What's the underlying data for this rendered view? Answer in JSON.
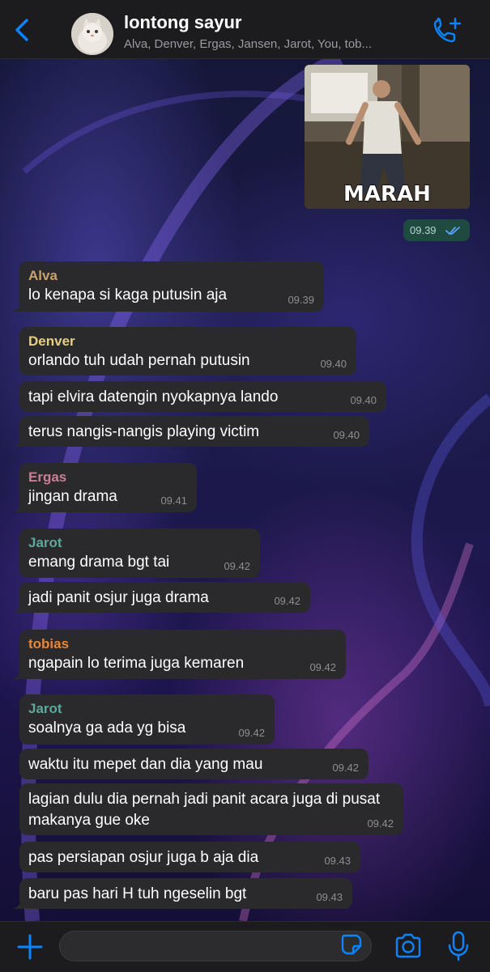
{
  "header": {
    "title": "lontong sayur",
    "subtitle": "Alva, Denver, Ergas, Jansen, Jarot, You, tob..."
  },
  "image_message": {
    "caption": "MARAH",
    "time": "09.39",
    "status": "read-double-check-icon"
  },
  "messages": [
    {
      "sender": "Alva",
      "sender_color": "#c8a26e",
      "text": "lo kenapa si kaga putusin aja",
      "time": "09.39"
    },
    {
      "sender": "Denver",
      "sender_color": "#e6cf86",
      "text": "orlando tuh udah pernah putusin",
      "time": "09.40"
    },
    {
      "sender": "",
      "text": "tapi elvira datengin nyokapnya lando",
      "time": "09.40"
    },
    {
      "sender": "",
      "text": "terus nangis-nangis playing victim",
      "time": "09.40"
    },
    {
      "sender": "Ergas",
      "sender_color": "#c97f93",
      "text": "jingan drama",
      "time": "09.41"
    },
    {
      "sender": "Jarot",
      "sender_color": "#5fa89c",
      "text": "emang drama bgt tai",
      "time": "09.42"
    },
    {
      "sender": "",
      "text": "jadi panit osjur juga drama",
      "time": "09.42"
    },
    {
      "sender": "tobias",
      "sender_color": "#e8863a",
      "text": "ngapain lo terima juga kemaren",
      "time": "09.42"
    },
    {
      "sender": "Jarot",
      "sender_color": "#5fa89c",
      "text": "soalnya ga ada yg bisa",
      "time": "09.42"
    },
    {
      "sender": "",
      "text": "waktu itu mepet dan dia yang mau",
      "time": "09.42"
    },
    {
      "sender": "",
      "text": "lagian dulu dia pernah jadi panit acara juga di pusat makanya gue oke",
      "time": "09.42"
    },
    {
      "sender": "",
      "text": "pas persiapan osjur juga b aja dia",
      "time": "09.43"
    },
    {
      "sender": "",
      "text": "baru pas hari H tuh ngeselin bgt",
      "time": "09.43"
    }
  ],
  "composer": {
    "placeholder": ""
  },
  "colors": {
    "header_bg": "#1c1c1e",
    "bubble_bg": "#2a2a2c",
    "accent": "#0a84ff",
    "outgoing_pill": "#1f4a3f"
  },
  "icons": {
    "back": "chevron-left-icon",
    "call": "phone-plus-icon",
    "plus": "plus-icon",
    "sticker": "sticker-icon",
    "camera": "camera-icon",
    "mic": "microphone-icon"
  }
}
